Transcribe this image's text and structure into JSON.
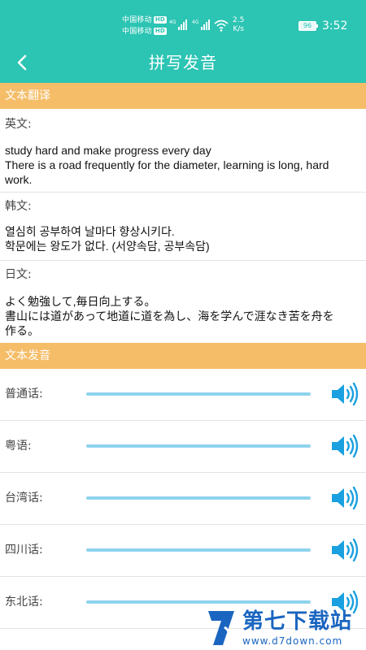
{
  "status_bar": {
    "carrier_1": "中国移动",
    "carrier_2": "中国移动",
    "hd_badge": "HD",
    "network_speed_value": "2.5",
    "network_speed_unit": "K/s",
    "battery": "96",
    "time": "3:52"
  },
  "header": {
    "title": "拼写发音"
  },
  "translation_section": {
    "title": "文本翻译",
    "english_label": "英文:",
    "english_lines": [
      "study hard and make progress every day",
      "There is a road frequently for the diameter, learning is long, hard",
      "work."
    ],
    "korean_label": "韩文:",
    "korean_lines": [
      "열심히 공부하여 날마다 향상시키다.",
      "학문에는 왕도가 없다. (서양속담, 공부속담)"
    ],
    "japanese_label": "日文:",
    "japanese_lines": [
      "よく勉強して,毎日向上する。",
      "書山には道があって地道に道を為し、海を学んで涯なき苦を舟を",
      "作る。"
    ]
  },
  "pronunciation_section": {
    "title": "文本发音",
    "voices": [
      {
        "label": "普通话:"
      },
      {
        "label": "粤语:"
      },
      {
        "label": "台湾话:"
      },
      {
        "label": "四川话:"
      },
      {
        "label": "东北话:"
      }
    ]
  },
  "watermark": {
    "name": "第七下载站",
    "url": "www.d7down.com"
  },
  "colors": {
    "header_teal": "#2cc4b3",
    "section_orange": "#f5bd68",
    "audio_line": "#8ed3ee",
    "speaker_blue": "#1aa0e0"
  }
}
